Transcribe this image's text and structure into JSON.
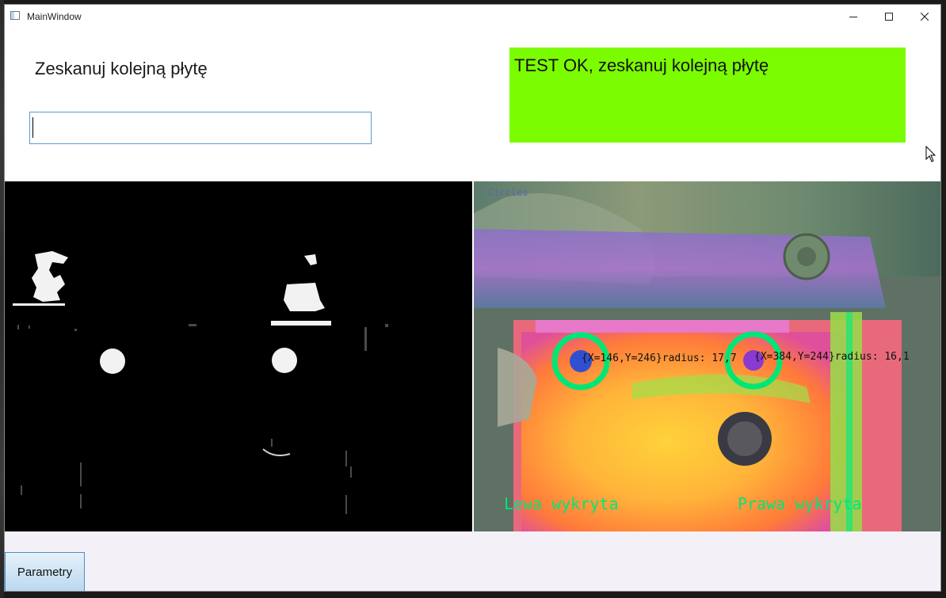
{
  "window": {
    "title": "MainWindow"
  },
  "scan": {
    "prompt": "Zeskanuj kolejną płytę",
    "input_value": "",
    "input_placeholder": ""
  },
  "status": {
    "text": "TEST OK, zeskanuj kolejną płytę",
    "color": "#7cfc00"
  },
  "camera": {
    "label": "Circles",
    "left_circle_info": "{X=146,Y=246}radius: 17,7",
    "right_circle_info": "{X=384,Y=244}radius: 16,1",
    "left_status": "Lewa wykryta",
    "right_status": "Prawa wykryta",
    "detection_color": "#00e676"
  },
  "buttons": {
    "params_label": "Parametry"
  },
  "icons": [
    "app-icon",
    "minimize-icon",
    "maximize-icon",
    "close-icon",
    "mouse-cursor-icon"
  ]
}
